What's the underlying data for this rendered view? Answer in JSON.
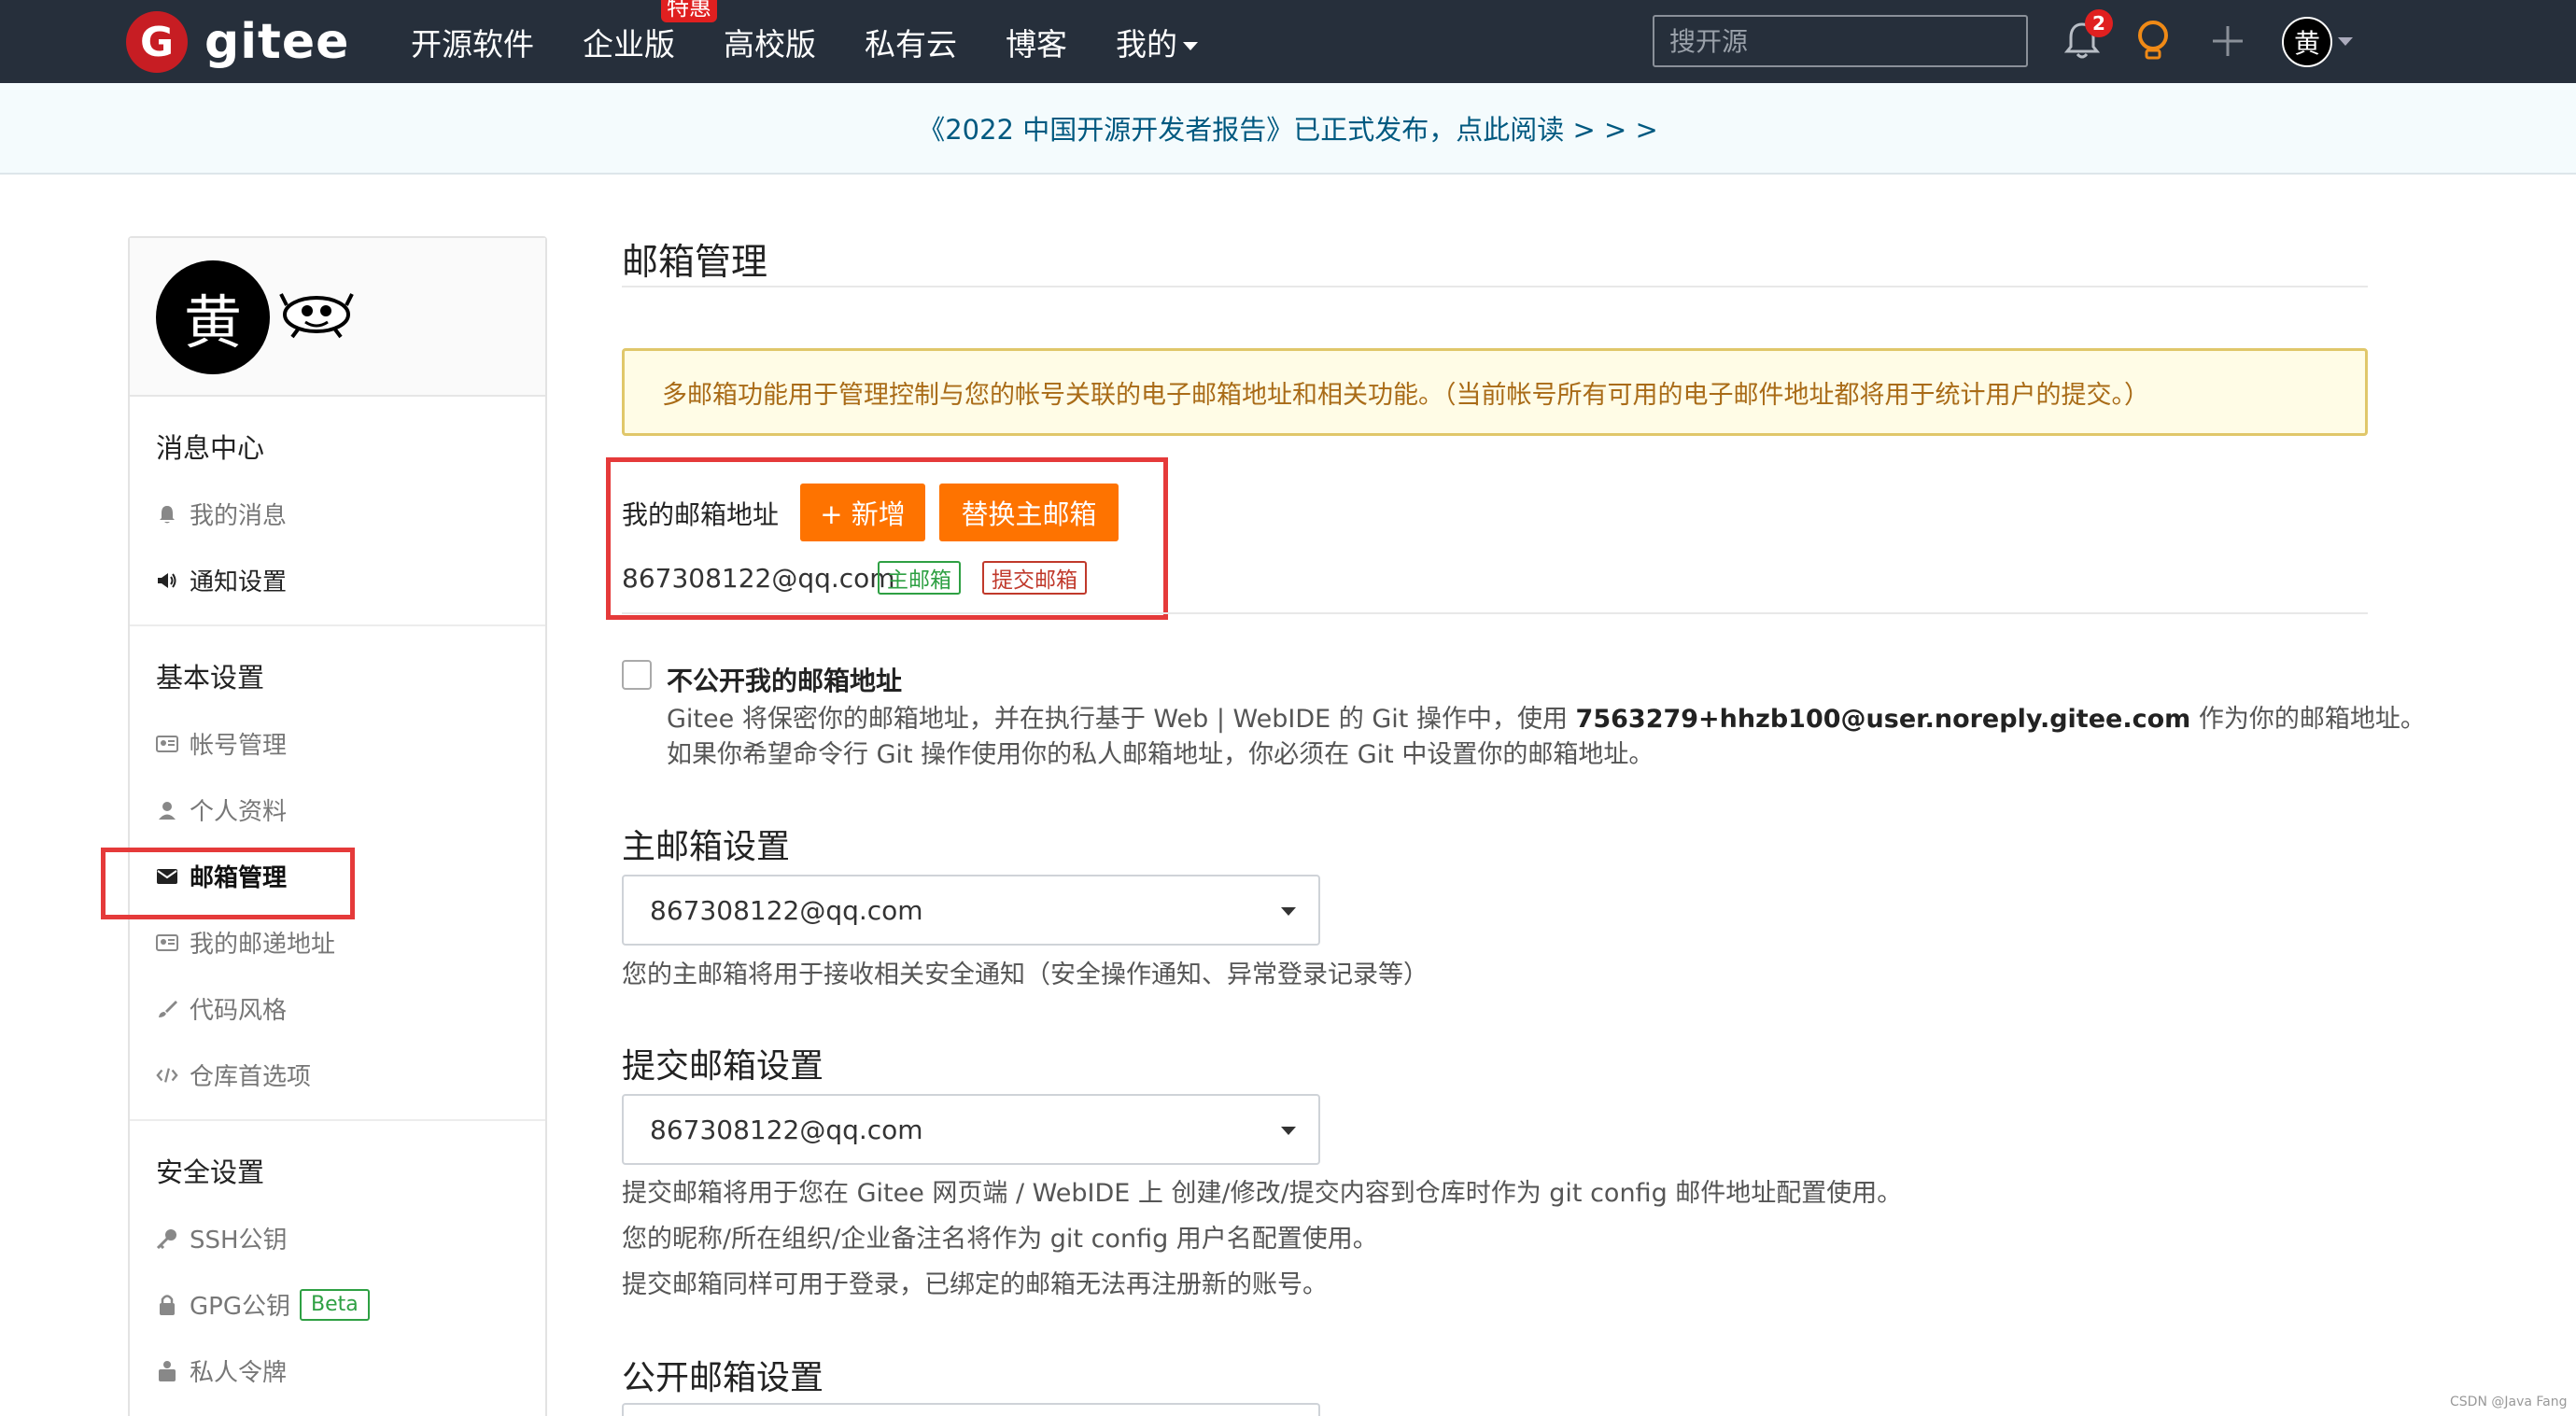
{
  "nav": {
    "logo_letter": "G",
    "logo_text": "gitee",
    "items": [
      {
        "label": "开源软件"
      },
      {
        "label": "企业版",
        "badge": "特惠"
      },
      {
        "label": "高校版"
      },
      {
        "label": "私有云"
      },
      {
        "label": "博客"
      },
      {
        "label": "我的"
      }
    ],
    "search_placeholder": "搜开源",
    "notification_count": "2",
    "avatar_char": "黄"
  },
  "announcement": "《2022 中国开源开发者报告》已正式发布，点此阅读 > > >",
  "sidebar": {
    "avatar_char": "黄",
    "groups": [
      {
        "title": "消息中心",
        "items": [
          {
            "label": "我的消息",
            "icon": "bell-icon"
          },
          {
            "label": "通知设置",
            "icon": "megaphone-icon"
          }
        ]
      },
      {
        "title": "基本设置",
        "items": [
          {
            "label": "帐号管理",
            "icon": "id-card-icon"
          },
          {
            "label": "个人资料",
            "icon": "user-icon"
          },
          {
            "label": "邮箱管理",
            "icon": "envelope-icon"
          },
          {
            "label": "我的邮递地址",
            "icon": "address-card-icon"
          },
          {
            "label": "代码风格",
            "icon": "brush-icon"
          },
          {
            "label": "仓库首选项",
            "icon": "code-icon"
          }
        ]
      },
      {
        "title": "安全设置",
        "items": [
          {
            "label": "SSH公钥",
            "icon": "key-icon"
          },
          {
            "label": "GPG公钥",
            "icon": "lock-icon",
            "badge": "Beta"
          },
          {
            "label": "私人令牌",
            "icon": "token-icon"
          }
        ]
      }
    ]
  },
  "main": {
    "title": "邮箱管理",
    "alert": "多邮箱功能用于管理控制与您的帐号关联的电子邮箱地址和相关功能。（当前帐号所有可用的电子邮件地址都将用于统计用户的提交。）",
    "my_emails_label": "我的邮箱地址",
    "add_button": "+ 新增",
    "replace_button": "替换主邮箱",
    "email": "867308122@qq.com",
    "tag_primary": "主邮箱",
    "tag_commit": "提交邮箱",
    "hide_email_label": "不公开我的邮箱地址",
    "hide_desc_1a": "Gitee 将保密你的邮箱地址，并在执行基于 Web | WebIDE 的 Git 操作中，使用 ",
    "hide_desc_1b": "7563279+hhzb100@user.noreply.gitee.com",
    "hide_desc_1c": " 作为你的邮箱地址。",
    "hide_desc_2": "如果你希望命令行 Git 操作使用你的私人邮箱地址，你必须在 Git 中设置你的邮箱地址。",
    "primary_title": "主邮箱设置",
    "primary_value": "867308122@qq.com",
    "primary_desc": "您的主邮箱将用于接收相关安全通知（安全操作通知、异常登录记录等）",
    "commit_title": "提交邮箱设置",
    "commit_value": "867308122@qq.com",
    "commit_desc_1": "提交邮箱将用于您在 Gitee 网页端 / WebIDE 上 创建/修改/提交内容到仓库时作为 git config 邮件地址配置使用。",
    "commit_desc_2": "您的昵称/所在组织/企业备注名将作为 git config 用户名配置使用。",
    "commit_desc_3": "提交邮箱同样可用于登录，已绑定的邮箱无法再注册新的账号。",
    "public_title": "公开邮箱设置"
  },
  "watermark": "CSDN @Java Fang",
  "colors": {
    "nav_bg": "#262f3b",
    "accent": "#fe7300",
    "brand": "#c71d23",
    "annotation": "#e53a3a"
  }
}
